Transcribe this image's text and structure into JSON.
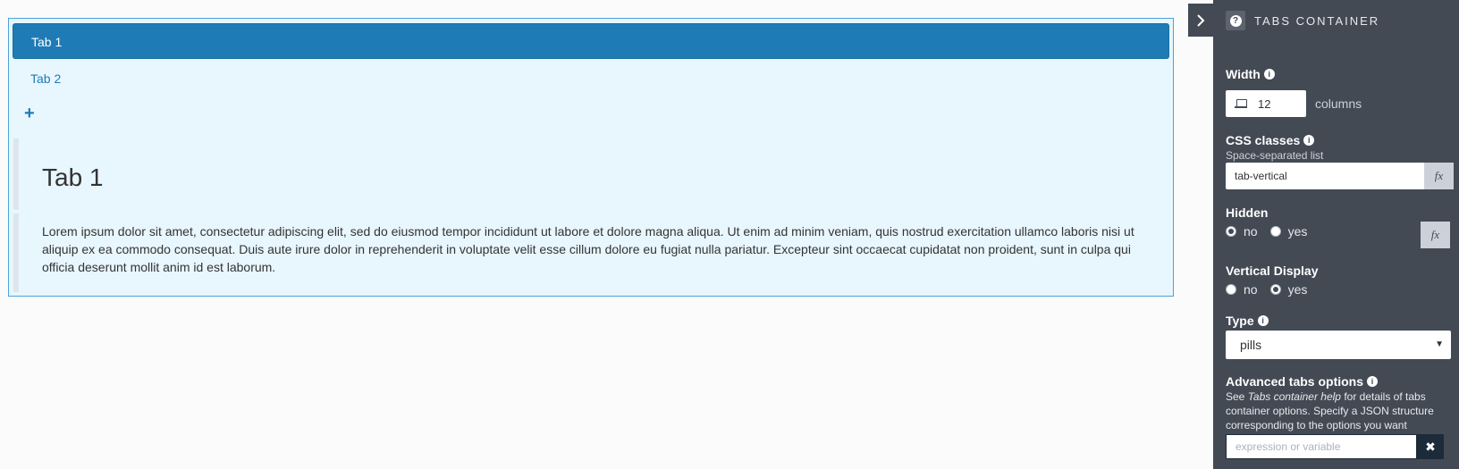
{
  "canvas": {
    "tabs": [
      {
        "label": "Tab 1"
      },
      {
        "label": "Tab 2"
      }
    ],
    "add_tab_symbol": "+",
    "pane": {
      "title": "Tab 1",
      "text": "Lorem ipsum dolor sit amet, consectetur adipiscing elit, sed do eiusmod tempor incididunt ut labore et dolore magna aliqua. Ut enim ad minim veniam, quis nostrud exercitation ullamco laboris nisi ut aliquip ex ea commodo consequat. Duis aute irure dolor in reprehenderit in voluptate velit esse cillum dolore eu fugiat nulla pariatur. Excepteur sint occaecat cupidatat non proident, sunt in culpa qui officia deserunt mollit anim id est laborum."
    }
  },
  "panel": {
    "title": "TABS CONTAINER",
    "help_symbol": "?",
    "info_symbol": "i",
    "width": {
      "label": "Width",
      "value": "12",
      "unit": "columns"
    },
    "css_classes": {
      "label": "CSS classes",
      "hint": "Space-separated list",
      "value": "tab-vertical"
    },
    "fx_label": "fx",
    "hidden": {
      "label": "Hidden",
      "options": [
        "no",
        "yes"
      ],
      "selected": "no"
    },
    "vertical_display": {
      "label": "Vertical Display",
      "options": [
        "no",
        "yes"
      ],
      "selected": "yes"
    },
    "type": {
      "label": "Type",
      "value": "pills"
    },
    "advanced": {
      "label": "Advanced tabs options",
      "desc_prefix": "See ",
      "desc_link": "Tabs container help",
      "desc_suffix": " for details of tabs container options. Specify a JSON structure corresponding to the options you want",
      "placeholder": "expression or variable"
    },
    "clear_symbol": "✖"
  },
  "colors": {
    "accent": "#1f7bb6",
    "panel_bg": "#434a54",
    "canvas_bg": "#e8f6fe"
  }
}
